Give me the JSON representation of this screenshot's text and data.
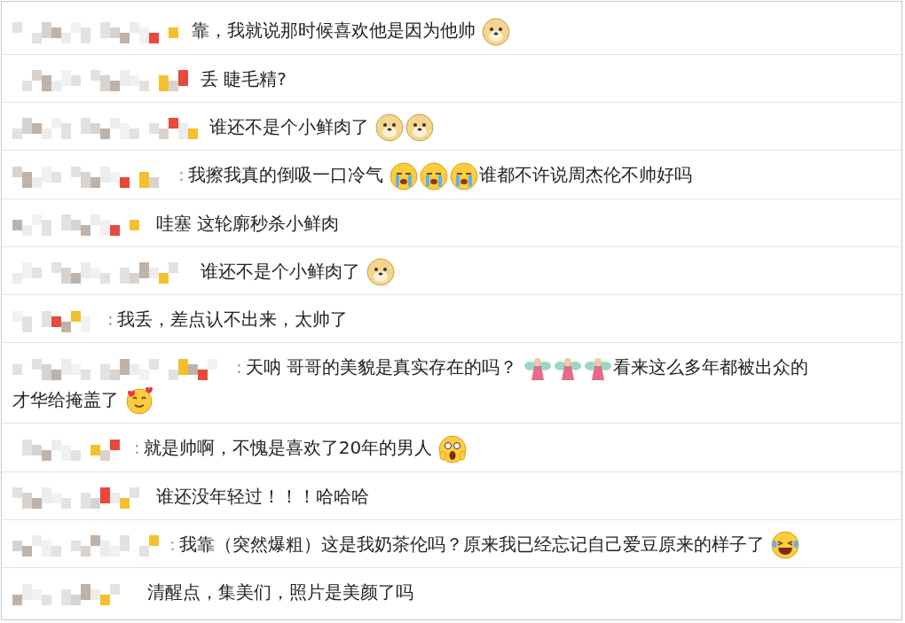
{
  "comments": [
    {
      "parts": [
        {
          "kind": "text",
          "text": "靠，我就说那时候喜欢他是因为他帅"
        },
        {
          "kind": "doge"
        }
      ]
    },
    {
      "parts": [
        {
          "kind": "text",
          "text": "丢  睫毛精?"
        }
      ]
    },
    {
      "parts": [
        {
          "kind": "text",
          "text": "谁还不是个小鲜肉了"
        },
        {
          "kind": "doge"
        },
        {
          "kind": "doge"
        }
      ]
    },
    {
      "separator": ":",
      "parts": [
        {
          "kind": "text",
          "text": "我擦我真的倒吸一口冷气"
        },
        {
          "kind": "cry"
        },
        {
          "kind": "cry"
        },
        {
          "kind": "cry"
        },
        {
          "kind": "text",
          "text": "谁都不许说周杰伦不帅好吗"
        }
      ]
    },
    {
      "parts": [
        {
          "kind": "text",
          "text": "哇塞 这轮廓秒杀小鲜肉"
        }
      ]
    },
    {
      "parts": [
        {
          "kind": "text",
          "text": "谁还不是个小鲜肉了"
        },
        {
          "kind": "doge"
        }
      ]
    },
    {
      "separator": ":",
      "parts": [
        {
          "kind": "text",
          "text": "我丢，差点认不出来，太帅了"
        }
      ]
    },
    {
      "separator": ":",
      "parts": [
        {
          "kind": "text",
          "text": "天呐 哥哥的美貌是真实存在的吗？"
        },
        {
          "kind": "fairy"
        },
        {
          "kind": "fairy"
        },
        {
          "kind": "fairy"
        },
        {
          "kind": "text",
          "text": "看来这么多年都被出众的"
        },
        {
          "kind": "text",
          "text": "才华给掩盖了"
        },
        {
          "kind": "hearts"
        }
      ]
    },
    {
      "separator": ":",
      "parts": [
        {
          "kind": "text",
          "text": "就是帅啊，不愧是喜欢了20年的男人"
        },
        {
          "kind": "scream"
        }
      ]
    },
    {
      "parts": [
        {
          "kind": "text",
          "text": "谁还没年轻过！！！哈哈哈"
        }
      ]
    },
    {
      "separator": ":",
      "parts": [
        {
          "kind": "text",
          "text": "我靠（突然爆粗）这是我奶茶伦吗？原来我已经忘记自己爱豆原来的样子了"
        },
        {
          "kind": "laugh"
        }
      ]
    },
    {
      "parts": [
        {
          "kind": "text",
          "text": "清醒点，集美们，照片是美颜了吗"
        }
      ]
    }
  ]
}
